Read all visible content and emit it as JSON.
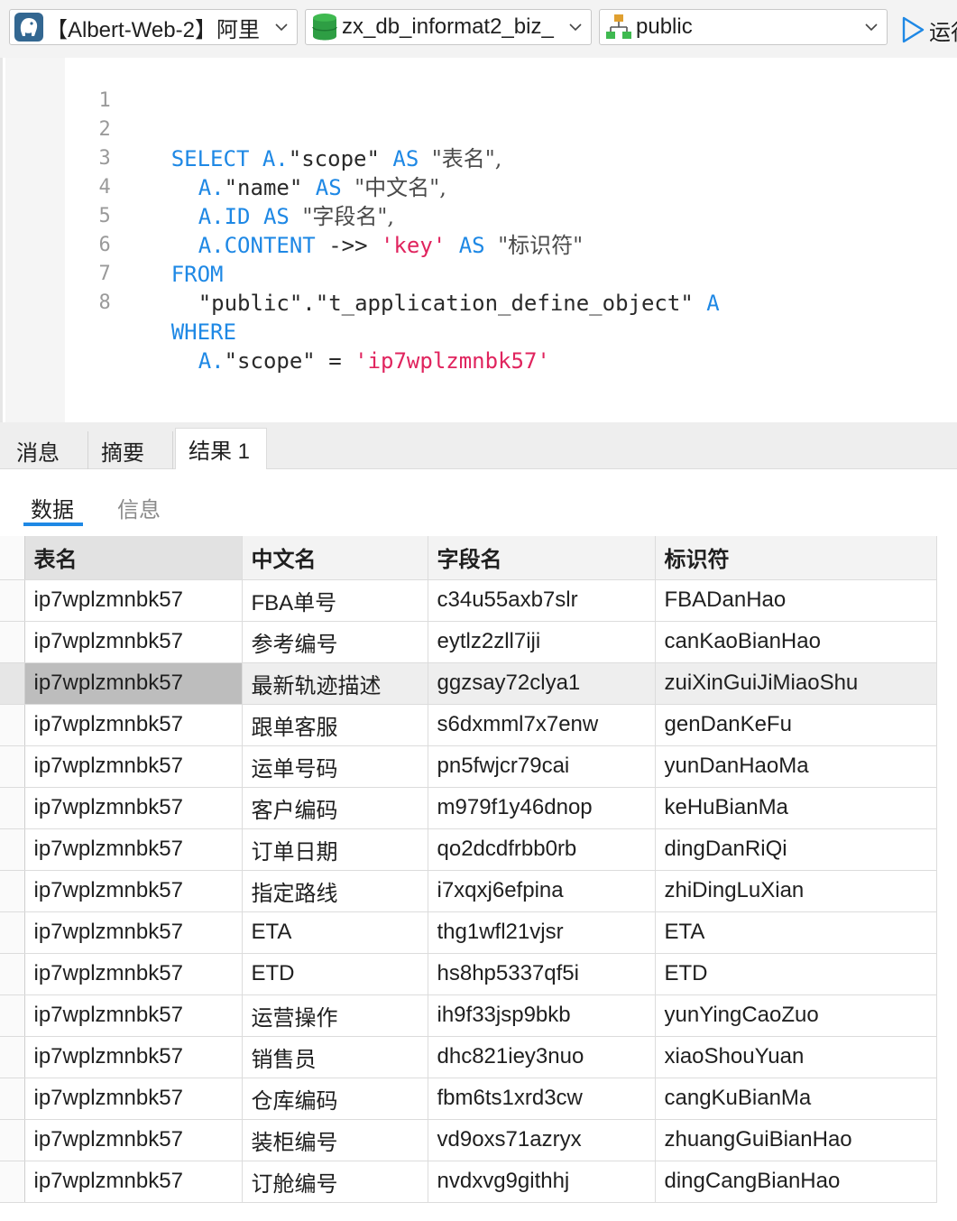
{
  "toolbar": {
    "connection": "【Albert-Web-2】阿里",
    "database": "zx_db_informat2_biz_",
    "schema": "public",
    "run_label": "运行"
  },
  "editor": {
    "lines": [
      {
        "n": "1"
      },
      {
        "n": "2"
      },
      {
        "n": "3"
      },
      {
        "n": "4"
      },
      {
        "n": "5"
      },
      {
        "n": "6"
      },
      {
        "n": "7"
      },
      {
        "n": "8"
      }
    ],
    "tokens": {
      "select": "SELECT",
      "a_dot": "A.",
      "scope_q": "\"scope\"",
      "as": "AS",
      "alias1": "\"表名\",",
      "name_q": "\"name\"",
      "alias2": "\"中文名\",",
      "id": "A.ID",
      "alias3": "\"字段名\",",
      "content": "A.CONTENT",
      "arrow": "->>",
      "key": "'key'",
      "alias4": "\"标识符\"",
      "from": "FROM",
      "table": "\"public\".\"t_application_define_object\"",
      "alias_a": "A",
      "where": "WHERE",
      "eq": "=",
      "value": "'ip7wplzmnbk57'"
    }
  },
  "result_tabs": [
    "消息",
    "摘要",
    "结果 1"
  ],
  "sub_tabs": [
    "数据",
    "信息"
  ],
  "grid": {
    "columns": [
      "表名",
      "中文名",
      "字段名",
      "标识符"
    ],
    "rows": [
      [
        "ip7wplzmnbk57",
        "FBA单号",
        "c34u55axb7slr",
        "FBADanHao"
      ],
      [
        "ip7wplzmnbk57",
        "参考编号",
        "eytlz2zll7iji",
        "canKaoBianHao"
      ],
      [
        "ip7wplzmnbk57",
        "最新轨迹描述",
        "ggzsay72clya1",
        "zuiXinGuiJiMiaoShu"
      ],
      [
        "ip7wplzmnbk57",
        "跟单客服",
        "s6dxmml7x7enw",
        "genDanKeFu"
      ],
      [
        "ip7wplzmnbk57",
        "运单号码",
        "pn5fwjcr79cai",
        "yunDanHaoMa"
      ],
      [
        "ip7wplzmnbk57",
        "客户编码",
        "m979f1y46dnop",
        "keHuBianMa"
      ],
      [
        "ip7wplzmnbk57",
        "订单日期",
        "qo2dcdfrbb0rb",
        "dingDanRiQi"
      ],
      [
        "ip7wplzmnbk57",
        "指定路线",
        "i7xqxj6efpina",
        "zhiDingLuXian"
      ],
      [
        "ip7wplzmnbk57",
        "ETA",
        "thg1wfl21vjsr",
        "ETA"
      ],
      [
        "ip7wplzmnbk57",
        "ETD",
        "hs8hp5337qf5i",
        "ETD"
      ],
      [
        "ip7wplzmnbk57",
        "运营操作",
        "ih9f33jsp9bkb",
        "yunYingCaoZuo"
      ],
      [
        "ip7wplzmnbk57",
        "销售员",
        "dhc821iey3nuo",
        "xiaoShouYuan"
      ],
      [
        "ip7wplzmnbk57",
        "仓库编码",
        "fbm6ts1xrd3cw",
        "cangKuBianMa"
      ],
      [
        "ip7wplzmnbk57",
        "装柜编号",
        "vd9oxs71azryx",
        "zhuangGuiBianHao"
      ],
      [
        "ip7wplzmnbk57",
        "订舱编号",
        "nvdxvg9githhj",
        "dingCangBianHao"
      ]
    ]
  },
  "icons": {
    "connection": "postgresql-elephant-icon",
    "database": "database-cylinder-icon",
    "schema": "schema-tree-icon",
    "run": "play-triangle-icon"
  },
  "colors": {
    "keyword": "#1e88e5",
    "string": "#e0245e",
    "active_underline": "#1e88e5"
  }
}
